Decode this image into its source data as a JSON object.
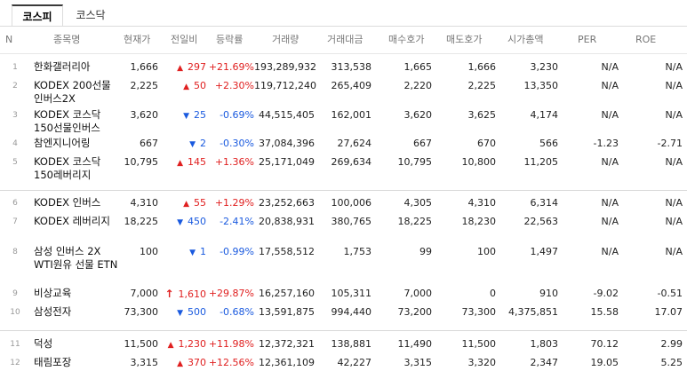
{
  "tabs": [
    "코스피",
    "코스닥"
  ],
  "columns": [
    "N",
    "종목명",
    "현재가",
    "전일비",
    "등락률",
    "거래량",
    "거래대금",
    "매수호가",
    "매도호가",
    "시가총액",
    "PER",
    "ROE"
  ],
  "rows": [
    {
      "n": "1",
      "name": "한화갤러리아",
      "price": "1,666",
      "arrow": "▲",
      "change": "297",
      "dir": "up",
      "rate": "+21.69%",
      "volume": "193,289,932",
      "amount": "313,538",
      "bid": "1,665",
      "ask": "1,666",
      "cap": "3,230",
      "per": "N/A",
      "roe": "N/A"
    },
    {
      "n": "2",
      "name": "KODEX 200선물인버스2X",
      "price": "2,225",
      "arrow": "▲",
      "change": "50",
      "dir": "up",
      "rate": "+2.30%",
      "volume": "119,712,240",
      "amount": "265,409",
      "bid": "2,220",
      "ask": "2,225",
      "cap": "13,350",
      "per": "N/A",
      "roe": "N/A"
    },
    {
      "n": "3",
      "name": "KODEX 코스닥150선물인버스",
      "price": "3,620",
      "arrow": "▼",
      "change": "25",
      "dir": "dn",
      "rate": "-0.69%",
      "volume": "44,515,405",
      "amount": "162,001",
      "bid": "3,620",
      "ask": "3,625",
      "cap": "4,174",
      "per": "N/A",
      "roe": "N/A"
    },
    {
      "n": "4",
      "name": "참엔지니어링",
      "price": "667",
      "arrow": "▼",
      "change": "2",
      "dir": "dn",
      "rate": "-0.30%",
      "volume": "37,084,396",
      "amount": "27,624",
      "bid": "667",
      "ask": "670",
      "cap": "566",
      "per": "-1.23",
      "roe": "-2.71"
    },
    {
      "n": "5",
      "name": "KODEX 코스닥150레버리지",
      "price": "10,795",
      "arrow": "▲",
      "change": "145",
      "dir": "up",
      "rate": "+1.36%",
      "volume": "25,171,049",
      "amount": "269,634",
      "bid": "10,795",
      "ask": "10,800",
      "cap": "11,205",
      "per": "N/A",
      "roe": "N/A"
    },
    {
      "n": "6",
      "name": "KODEX 인버스",
      "price": "4,310",
      "arrow": "▲",
      "change": "55",
      "dir": "up",
      "rate": "+1.29%",
      "volume": "23,252,663",
      "amount": "100,006",
      "bid": "4,305",
      "ask": "4,310",
      "cap": "6,314",
      "per": "N/A",
      "roe": "N/A"
    },
    {
      "n": "7",
      "name": "KODEX 레버리지",
      "price": "18,225",
      "arrow": "▼",
      "change": "450",
      "dir": "dn",
      "rate": "-2.41%",
      "volume": "20,838,931",
      "amount": "380,765",
      "bid": "18,225",
      "ask": "18,230",
      "cap": "22,563",
      "per": "N/A",
      "roe": "N/A"
    },
    {
      "n": "8",
      "name": "삼성 인버스 2X WTI원유 선물 ETN",
      "price": "100",
      "arrow": "▼",
      "change": "1",
      "dir": "dn",
      "rate": "-0.99%",
      "volume": "17,558,512",
      "amount": "1,753",
      "bid": "99",
      "ask": "100",
      "cap": "1,497",
      "per": "N/A",
      "roe": "N/A"
    },
    {
      "n": "9",
      "name": "비상교육",
      "price": "7,000",
      "arrow": "↑",
      "change": "1,610",
      "dir": "up",
      "rate": "+29.87%",
      "volume": "16,257,160",
      "amount": "105,311",
      "bid": "7,000",
      "ask": "0",
      "cap": "910",
      "per": "-9.02",
      "roe": "-0.51"
    },
    {
      "n": "10",
      "name": "삼성전자",
      "price": "73,300",
      "arrow": "▼",
      "change": "500",
      "dir": "dn",
      "rate": "-0.68%",
      "volume": "13,591,875",
      "amount": "994,440",
      "bid": "73,200",
      "ask": "73,300",
      "cap": "4,375,851",
      "per": "15.58",
      "roe": "17.07"
    },
    {
      "n": "11",
      "name": "덕성",
      "price": "11,500",
      "arrow": "▲",
      "change": "1,230",
      "dir": "up",
      "rate": "+11.98%",
      "volume": "12,372,321",
      "amount": "138,881",
      "bid": "11,490",
      "ask": "11,500",
      "cap": "1,803",
      "per": "70.12",
      "roe": "2.99"
    },
    {
      "n": "12",
      "name": "태림포장",
      "price": "3,315",
      "arrow": "▲",
      "change": "370",
      "dir": "up",
      "rate": "+12.56%",
      "volume": "12,361,109",
      "amount": "42,227",
      "bid": "3,315",
      "ask": "3,320",
      "cap": "2,347",
      "per": "19.05",
      "roe": "5.25"
    }
  ]
}
